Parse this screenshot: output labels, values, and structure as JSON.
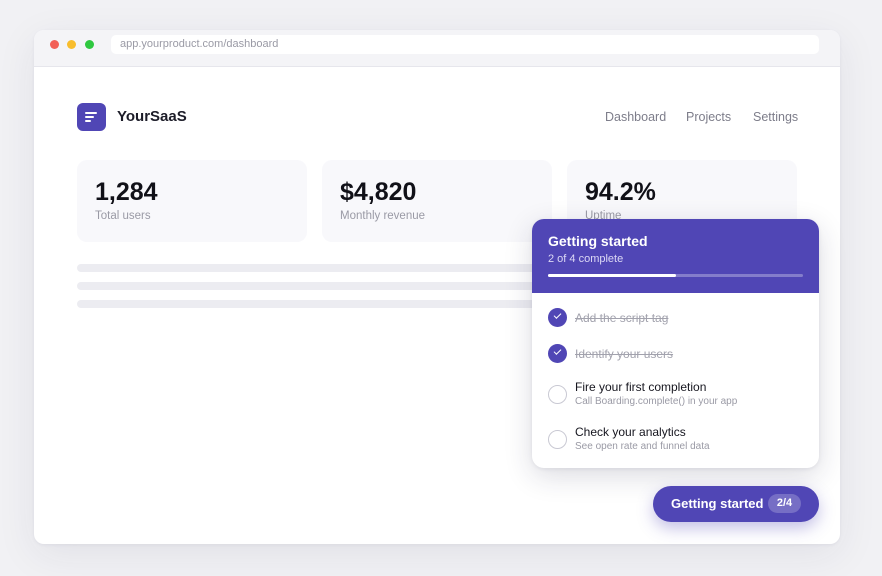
{
  "browser": {
    "url": "app.yourproduct.com/dashboard"
  },
  "app": {
    "brand": "YourSaaS"
  },
  "nav": [
    "Dashboard",
    "Projects",
    "Settings"
  ],
  "stats": [
    {
      "value": "1,284",
      "label": "Total users"
    },
    {
      "value": "$4,820",
      "label": "Monthly revenue"
    },
    {
      "value": "94.2%",
      "label": "Uptime"
    }
  ],
  "checklist": {
    "title": "Getting started",
    "progress_text": "2 of 4 complete",
    "progress_fraction": 0.5,
    "accent_color": "#5046b5",
    "tasks": [
      {
        "title": "Add the script tag",
        "description": "",
        "done": true
      },
      {
        "title": "Identify your users",
        "description": "",
        "done": true
      },
      {
        "title": "Fire your first completion",
        "description": "Call Boarding.complete() in your app",
        "done": false
      },
      {
        "title": "Check your analytics",
        "description": "See open rate and funnel data",
        "done": false
      }
    ]
  },
  "launcher": {
    "label": "Getting started",
    "badge": "2/4"
  }
}
